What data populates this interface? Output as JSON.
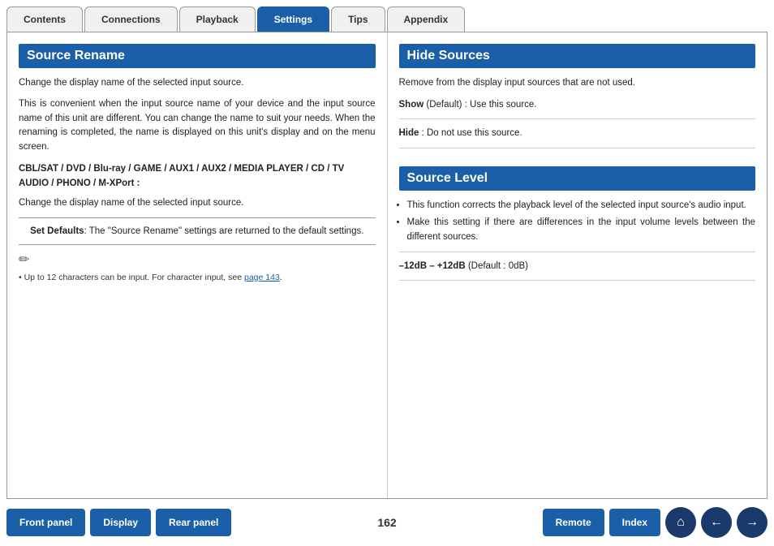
{
  "tabs": [
    {
      "label": "Contents",
      "active": false
    },
    {
      "label": "Connections",
      "active": false
    },
    {
      "label": "Playback",
      "active": false
    },
    {
      "label": "Settings",
      "active": true
    },
    {
      "label": "Tips",
      "active": false
    },
    {
      "label": "Appendix",
      "active": false
    }
  ],
  "left": {
    "title": "Source Rename",
    "intro1": "Change the display name of the selected input source.",
    "intro2": "This is convenient when the input source name of your device and the input source name of this unit are different. You can change the name to suit your needs. When the renaming is completed, the name is displayed on this unit's display and on the menu screen.",
    "sources": "CBL/SAT / DVD / Blu-ray / GAME / AUX1 / AUX2 / MEDIA PLAYER / CD / TV AUDIO / PHONO / M-XPort :",
    "sources_desc": "Change the display name of the selected input source.",
    "set_defaults_label": "Set Defaults",
    "set_defaults_text": ": The \"Source Rename\" settings are returned to the default settings.",
    "note_icon": "✏",
    "note_text": "• Up to 12 characters can be input. For character input, see ",
    "note_link": "page 143",
    "note_link_suffix": "."
  },
  "right": {
    "hide_sources": {
      "title": "Hide Sources",
      "desc": "Remove from the display input sources that are not used.",
      "show_label": "Show",
      "show_text": " (Default) : Use this source.",
      "hide_label": "Hide",
      "hide_text": " : Do not use this source."
    },
    "source_level": {
      "title": "Source Level",
      "bullet1": "This function corrects the playback level of the selected input source's audio input.",
      "bullet2": "Make this setting if there are differences in the input volume levels between the different sources.",
      "range_bold": "–12dB – +12dB",
      "range_text": " (Default : 0dB)"
    }
  },
  "bottom": {
    "page_number": "162",
    "buttons": [
      {
        "label": "Front panel",
        "name": "front-panel-button"
      },
      {
        "label": "Display",
        "name": "display-button"
      },
      {
        "label": "Rear panel",
        "name": "rear-panel-button"
      },
      {
        "label": "Remote",
        "name": "remote-button"
      },
      {
        "label": "Index",
        "name": "index-button"
      }
    ],
    "home_icon": "⌂",
    "back_icon": "←",
    "forward_icon": "→"
  }
}
